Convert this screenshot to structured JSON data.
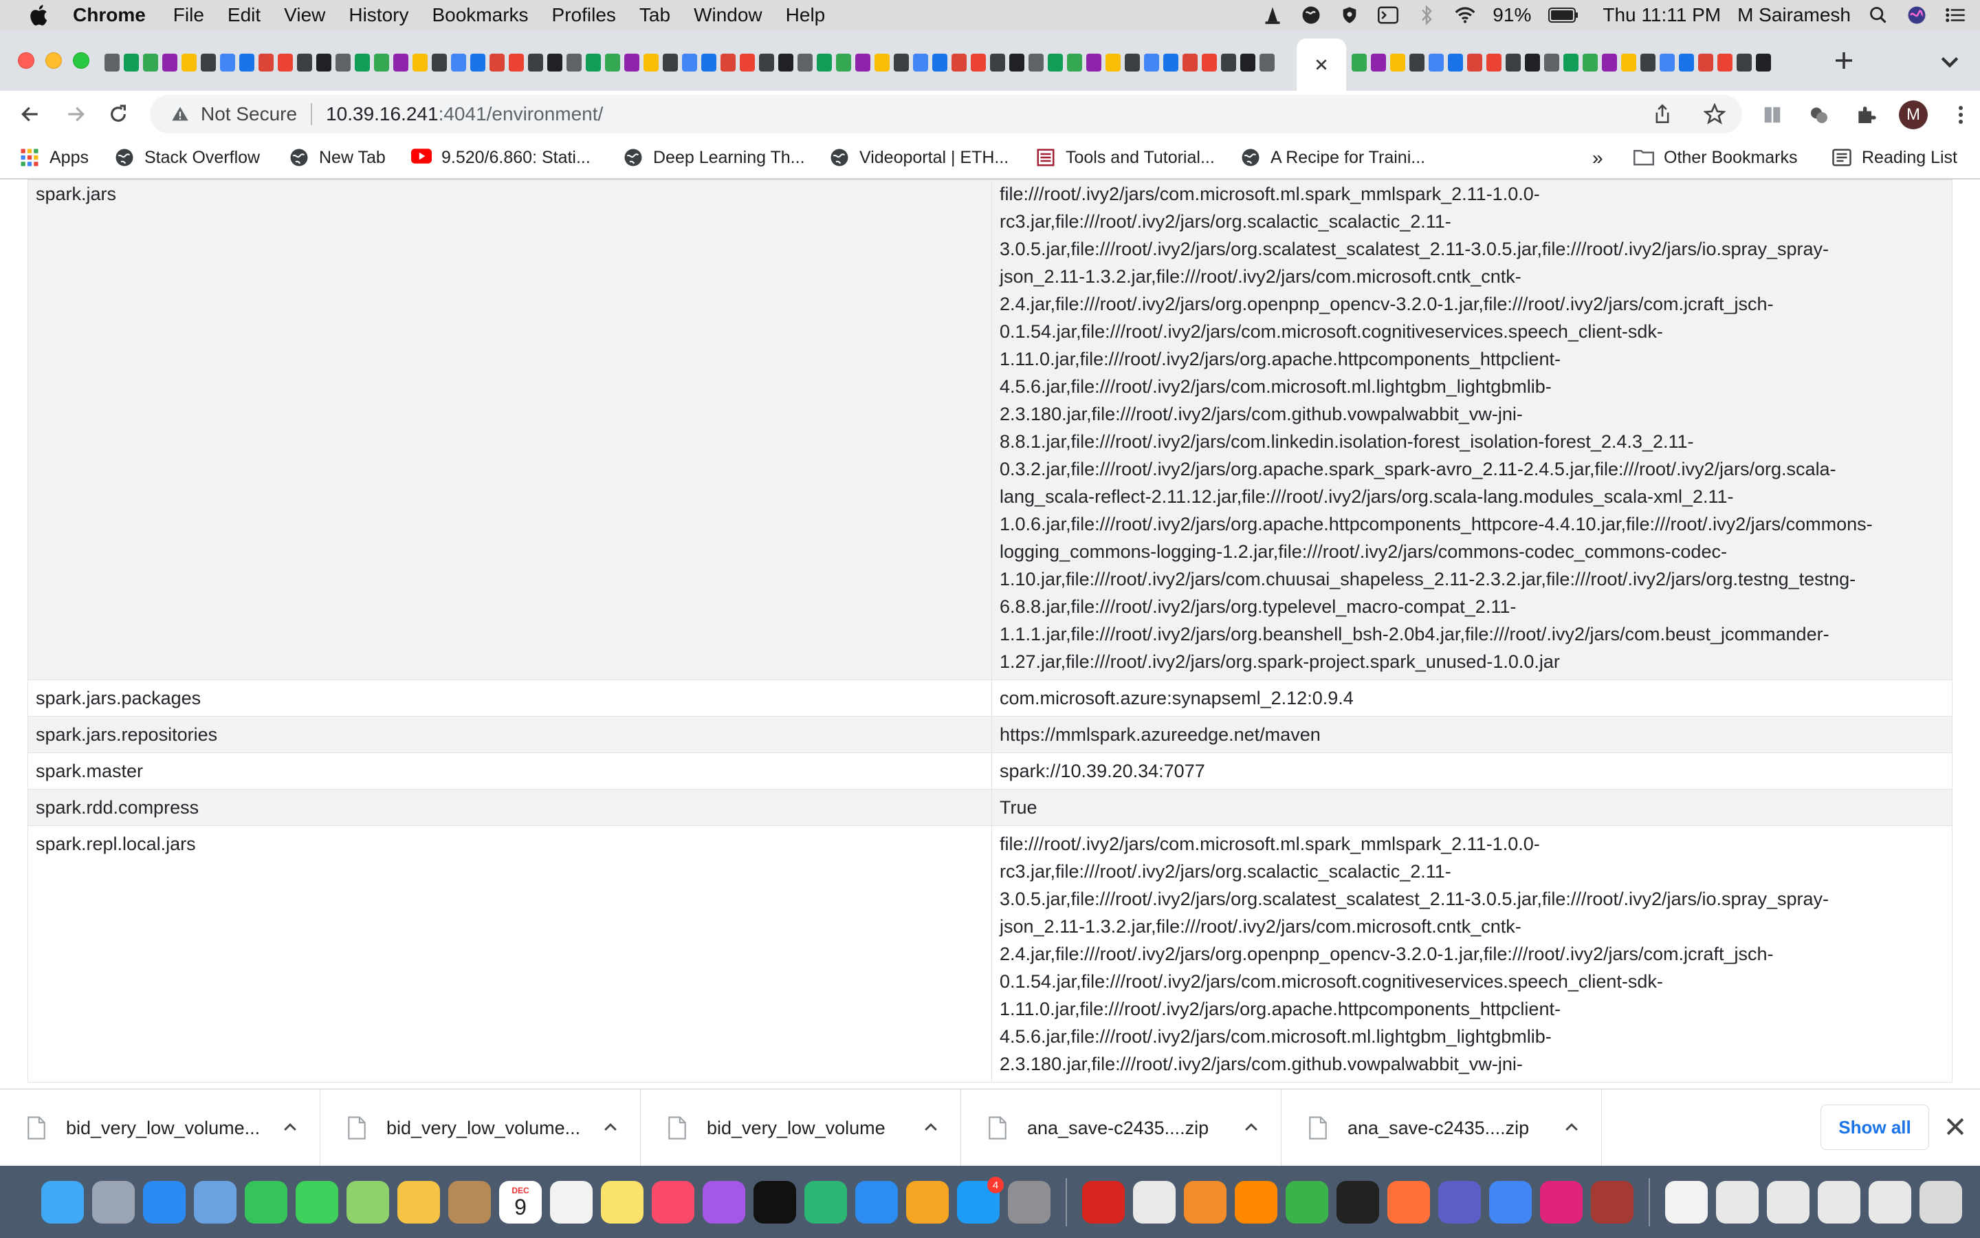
{
  "menubar": {
    "app_name": "Chrome",
    "items": [
      "File",
      "Edit",
      "View",
      "History",
      "Bookmarks",
      "Profiles",
      "Tab",
      "Window",
      "Help"
    ],
    "battery": "91%",
    "clock": "Thu 11:11 PM",
    "user": "M Sairamesh"
  },
  "toolbar": {
    "security_label": "Not Secure",
    "url_host": "10.39.16.241",
    "url_path": ":4041/environment/",
    "profile_initial": "M"
  },
  "bookmarks": {
    "apps": "Apps",
    "items": [
      "Stack Overflow",
      "New Tab",
      "9.520/6.860: Stati...",
      "Deep Learning Th...",
      "Videoportal | ETH...",
      "Tools and Tutorial...",
      "A Recipe for Traini..."
    ],
    "overflow": "»",
    "other": "Other Bookmarks",
    "reading_list": "Reading List"
  },
  "environment": {
    "rows": [
      {
        "key": "spark.jars",
        "lines": [
          "file:///root/.ivy2/jars/com.microsoft.ml.spark_mmlspark_2.11-1.0.0-",
          "rc3.jar,file:///root/.ivy2/jars/org.scalactic_scalactic_2.11-",
          "3.0.5.jar,file:///root/.ivy2/jars/org.scalatest_scalatest_2.11-3.0.5.jar,file:///root/.ivy2/jars/io.spray_spray-",
          "json_2.11-1.3.2.jar,file:///root/.ivy2/jars/com.microsoft.cntk_cntk-",
          "2.4.jar,file:///root/.ivy2/jars/org.openpnp_opencv-3.2.0-1.jar,file:///root/.ivy2/jars/com.jcraft_jsch-",
          "0.1.54.jar,file:///root/.ivy2/jars/com.microsoft.cognitiveservices.speech_client-sdk-",
          "1.11.0.jar,file:///root/.ivy2/jars/org.apache.httpcomponents_httpclient-",
          "4.5.6.jar,file:///root/.ivy2/jars/com.microsoft.ml.lightgbm_lightgbmlib-",
          "2.3.180.jar,file:///root/.ivy2/jars/com.github.vowpalwabbit_vw-jni-",
          "8.8.1.jar,file:///root/.ivy2/jars/com.linkedin.isolation-forest_isolation-forest_2.4.3_2.11-",
          "0.3.2.jar,file:///root/.ivy2/jars/org.apache.spark_spark-avro_2.11-2.4.5.jar,file:///root/.ivy2/jars/org.scala-",
          "lang_scala-reflect-2.11.12.jar,file:///root/.ivy2/jars/org.scala-lang.modules_scala-xml_2.11-",
          "1.0.6.jar,file:///root/.ivy2/jars/org.apache.httpcomponents_httpcore-4.4.10.jar,file:///root/.ivy2/jars/commons-",
          "logging_commons-logging-1.2.jar,file:///root/.ivy2/jars/commons-codec_commons-codec-",
          "1.10.jar,file:///root/.ivy2/jars/com.chuusai_shapeless_2.11-2.3.2.jar,file:///root/.ivy2/jars/org.testng_testng-",
          "6.8.8.jar,file:///root/.ivy2/jars/org.typelevel_macro-compat_2.11-",
          "1.1.1.jar,file:///root/.ivy2/jars/org.beanshell_bsh-2.0b4.jar,file:///root/.ivy2/jars/com.beust_jcommander-",
          "1.27.jar,file:///root/.ivy2/jars/org.spark-project.spark_unused-1.0.0.jar"
        ]
      },
      {
        "key": "spark.jars.packages",
        "lines": [
          "com.microsoft.azure:synapseml_2.12:0.9.4"
        ]
      },
      {
        "key": "spark.jars.repositories",
        "lines": [
          "https://mmlspark.azureedge.net/maven"
        ]
      },
      {
        "key": "spark.master",
        "lines": [
          "spark://10.39.20.34:7077"
        ]
      },
      {
        "key": "spark.rdd.compress",
        "lines": [
          "True"
        ]
      },
      {
        "key": "spark.repl.local.jars",
        "lines": [
          "file:///root/.ivy2/jars/com.microsoft.ml.spark_mmlspark_2.11-1.0.0-",
          "rc3.jar,file:///root/.ivy2/jars/org.scalactic_scalactic_2.11-",
          "3.0.5.jar,file:///root/.ivy2/jars/org.scalatest_scalatest_2.11-3.0.5.jar,file:///root/.ivy2/jars/io.spray_spray-",
          "json_2.11-1.3.2.jar,file:///root/.ivy2/jars/com.microsoft.cntk_cntk-",
          "2.4.jar,file:///root/.ivy2/jars/org.openpnp_opencv-3.2.0-1.jar,file:///root/.ivy2/jars/com.jcraft_jsch-",
          "0.1.54.jar,file:///root/.ivy2/jars/com.microsoft.cognitiveservices.speech_client-sdk-",
          "1.11.0.jar,file:///root/.ivy2/jars/org.apache.httpcomponents_httpclient-",
          "4.5.6.jar,file:///root/.ivy2/jars/com.microsoft.ml.lightgbm_lightgbmlib-",
          "2.3.180.jar,file:///root/.ivy2/jars/com.github.vowpalwabbit_vw-jni-"
        ]
      }
    ]
  },
  "downloads": {
    "items": [
      "bid_very_low_volume...",
      "bid_very_low_volume...",
      "bid_very_low_volume",
      "ana_save-c2435....zip",
      "ana_save-c2435....zip"
    ],
    "show_all": "Show all"
  },
  "dock": {
    "calendar_month": "DEC",
    "calendar_day": "9",
    "appstore_badge": "4"
  }
}
